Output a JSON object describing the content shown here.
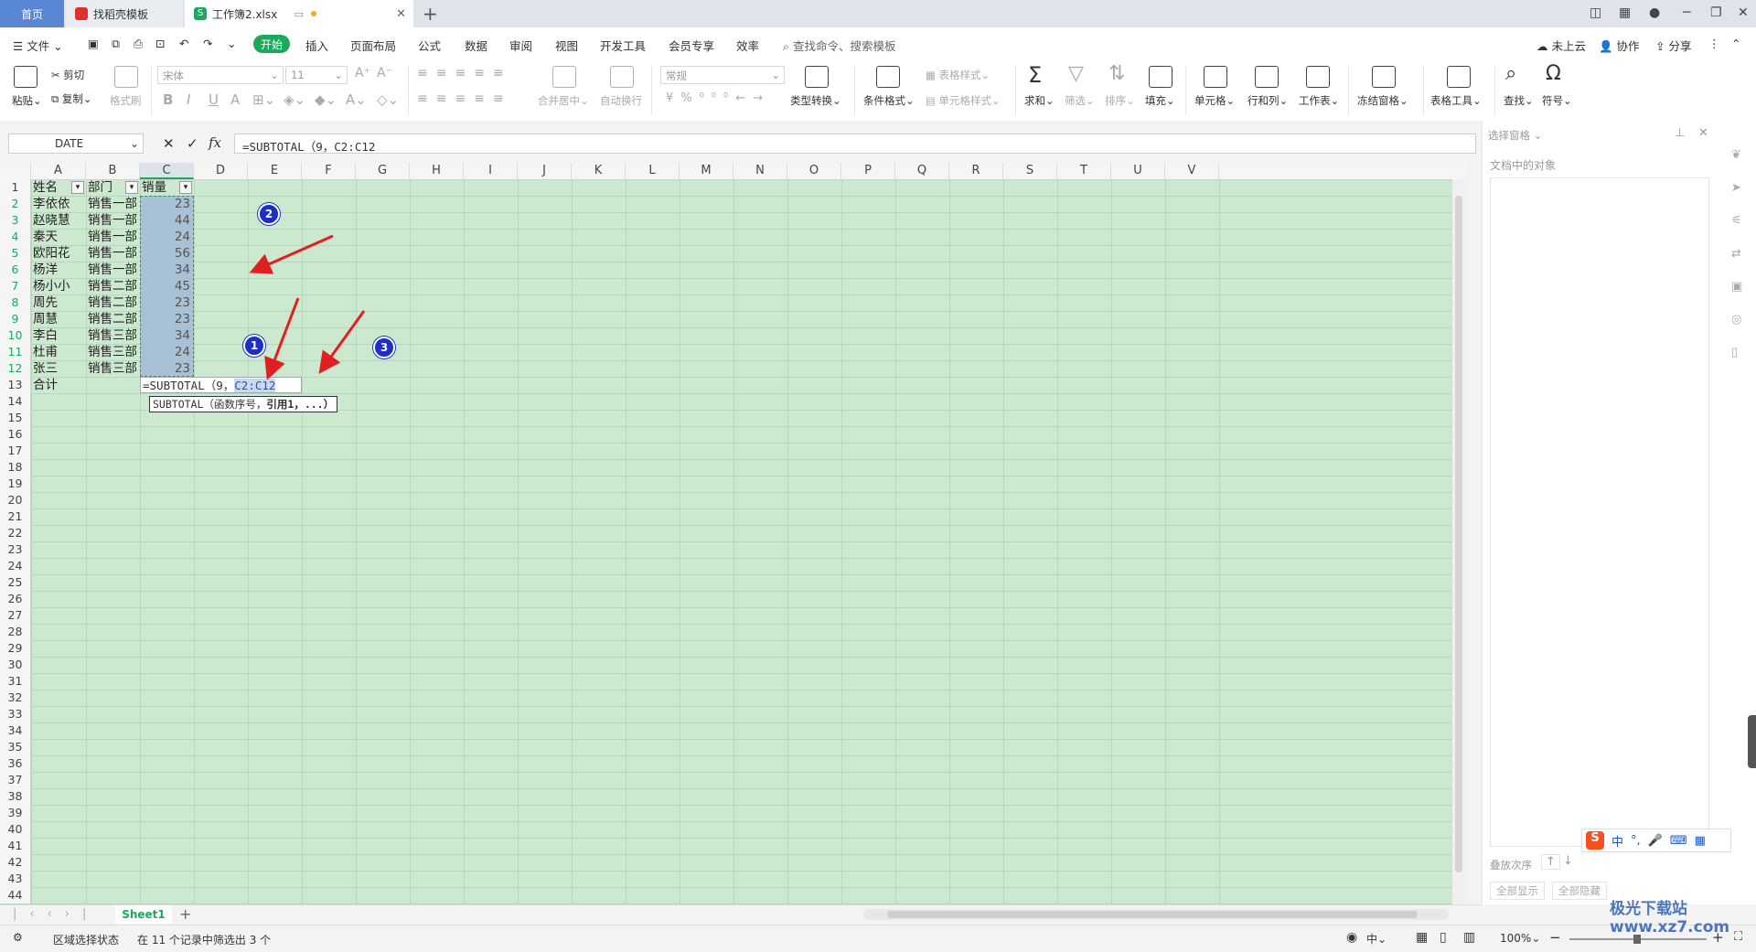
{
  "tabs": {
    "home": "首页",
    "template": "找稻壳模板",
    "workbook": "工作簿2.xlsx"
  },
  "menu": {
    "file": "文件",
    "items": [
      "开始",
      "插入",
      "页面布局",
      "公式",
      "数据",
      "审阅",
      "视图",
      "开发工具",
      "会员专享",
      "效率"
    ],
    "search_placeholder": "查找命令、搜索模板",
    "cloud": "未上云",
    "collab": "协作",
    "share": "分享"
  },
  "ribbon": {
    "paste": "粘贴",
    "cut": "剪切",
    "copy": "复制",
    "format_painter": "格式刷",
    "font_name": "宋体",
    "font_size": "11",
    "merge_center": "合并居中",
    "wrap": "自动换行",
    "number_format": "常规",
    "type_convert": "类型转换",
    "cond_format": "条件格式",
    "table_style": "表格样式",
    "cell_style": "单元格样式",
    "sum": "求和",
    "filter": "筛选",
    "sort": "排序",
    "fill": "填充",
    "cell": "单元格",
    "row_col": "行和列",
    "worksheet": "工作表",
    "freeze": "冻结窗格",
    "table_tools": "表格工具",
    "find": "查找",
    "symbol": "符号"
  },
  "formula_bar": {
    "name_box": "DATE",
    "fx": "fx",
    "formula": "=SUBTOTAL（9，C2:C12"
  },
  "sheet": {
    "columns": [
      "A",
      "B",
      "C",
      "D",
      "E",
      "F",
      "G",
      "H",
      "I",
      "J",
      "K",
      "L",
      "M",
      "N",
      "O",
      "P",
      "Q",
      "R",
      "S",
      "T",
      "U",
      "V"
    ],
    "headers": [
      "姓名",
      "部门",
      "销量"
    ],
    "rows": [
      [
        "李依依",
        "销售一部",
        "23"
      ],
      [
        "赵晓慧",
        "销售一部",
        "44"
      ],
      [
        "秦天",
        "销售一部",
        "24"
      ],
      [
        "欧阳花",
        "销售一部",
        "56"
      ],
      [
        "杨洋",
        "销售一部",
        "34"
      ],
      [
        "杨小小",
        "销售二部",
        "45"
      ],
      [
        "周先",
        "销售二部",
        "23"
      ],
      [
        "周慧",
        "销售二部",
        "23"
      ],
      [
        "李白",
        "销售三部",
        "34"
      ],
      [
        "杜甫",
        "销售三部",
        "24"
      ],
      [
        "张三",
        "销售三部",
        "23"
      ]
    ],
    "total_label": "合计",
    "edit_prefix": "=SUBTOTAL（9，",
    "edit_ref": "C2:C12",
    "tooltip_plain": "SUBTOTAL（函数序号，",
    "tooltip_bold": "引用1，...）",
    "badges": [
      "1",
      "2",
      "3"
    ]
  },
  "right_pane": {
    "title": "选择窗格",
    "objects_label": "文档中的对象",
    "order_label": "叠放次序",
    "show_all": "全部显示",
    "hide_all": "全部隐藏"
  },
  "sheet_tabs": {
    "active": "Sheet1"
  },
  "status": {
    "mode": "区域选择状态",
    "filter_info": "在 11 个记录中筛选出 3 个",
    "zoom": "100%",
    "ime": "中"
  },
  "watermark": "极光下载站\nwww.xz7.com",
  "colors": {
    "grid_bg": "#cce8cf",
    "accent": "#1ea85c",
    "selection": "#a8c1d4",
    "badge": "#1b2fc7",
    "arrow": "#e02020"
  }
}
